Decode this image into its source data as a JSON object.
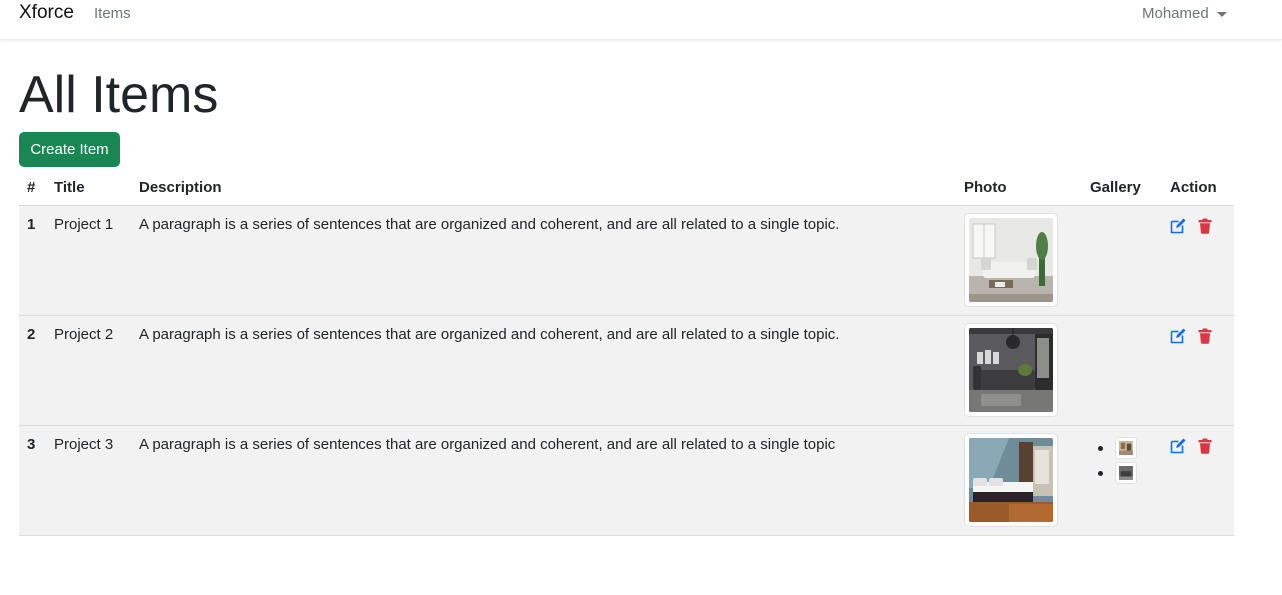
{
  "navbar": {
    "brand": "Xforce",
    "items_link": "Items",
    "user": "Mohamed"
  },
  "page": {
    "title": "All Items",
    "create_button": "Create Item"
  },
  "table": {
    "headers": [
      "#",
      "Title",
      "Description",
      "Photo",
      "Gallery",
      "Action"
    ],
    "rows": [
      {
        "num": "1",
        "title": "Project 1",
        "description": "A paragraph is a series of sentences that are organized and coherent, and are all related to a single topic.",
        "photo": "living-room-white-sofa",
        "gallery": []
      },
      {
        "num": "2",
        "title": "Project 2",
        "description": "A paragraph is a series of sentences that are organized and coherent, and are all related to a single topic.",
        "photo": "living-room-dark-sofa",
        "gallery": []
      },
      {
        "num": "3",
        "title": "Project 3",
        "description": "A paragraph is a series of sentences that are organized and coherent, and are all related to a single topic",
        "photo": "bedroom",
        "gallery": [
          "gallery-thumb-1",
          "gallery-thumb-2"
        ]
      }
    ]
  },
  "icons": {
    "edit": "edit-icon",
    "delete": "trash-icon"
  },
  "colors": {
    "create_button": "#198754",
    "edit_icon": "#0d6efd",
    "delete_icon": "#dc3545",
    "row_background": "#f2f2f2"
  }
}
